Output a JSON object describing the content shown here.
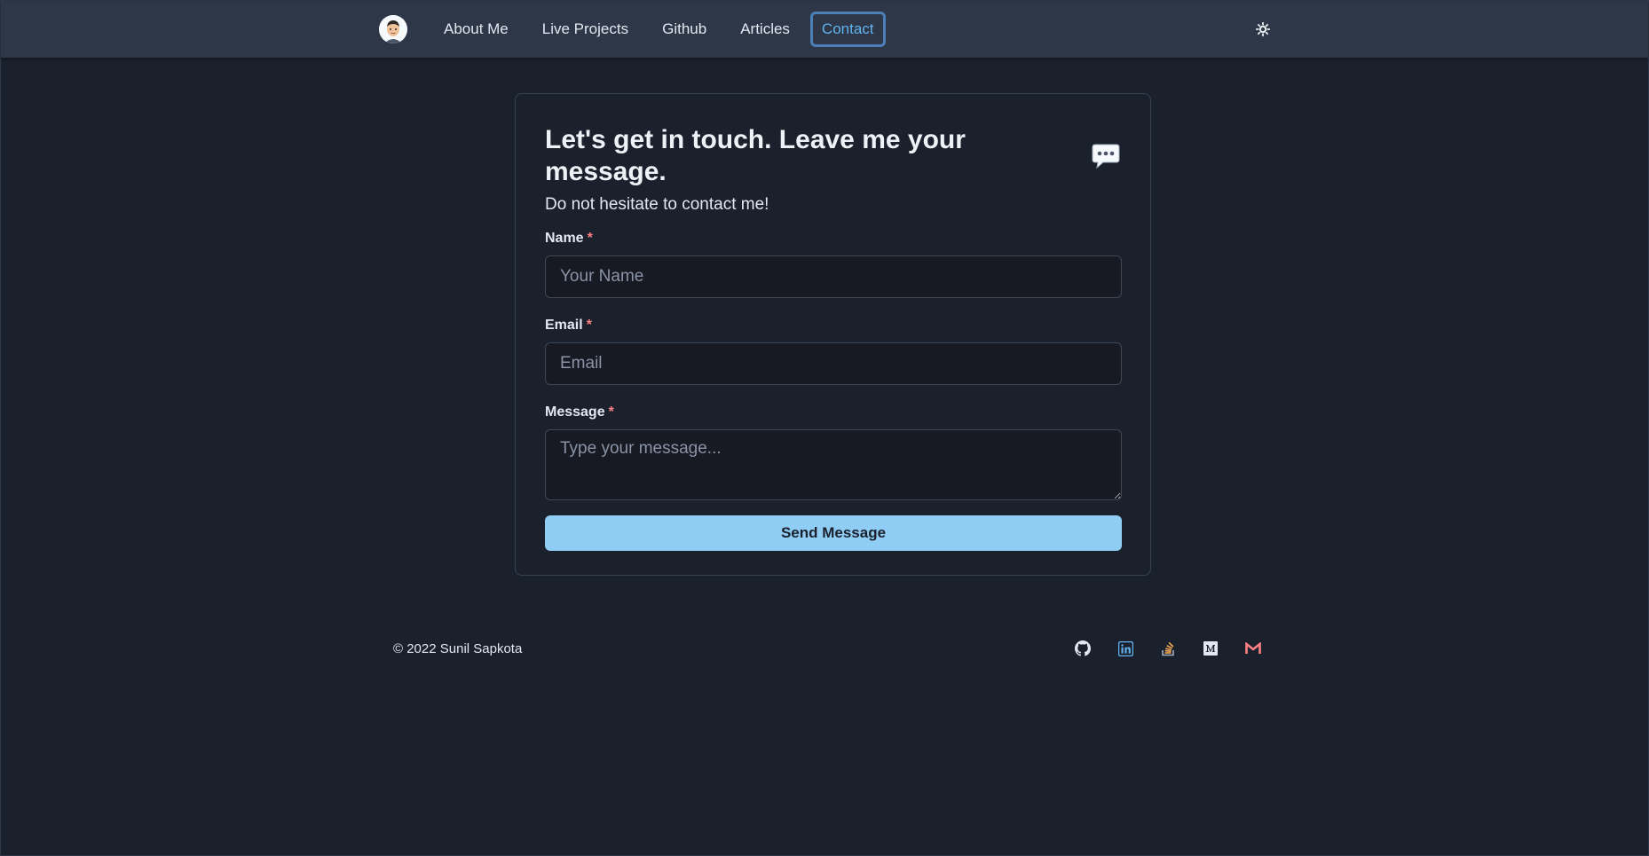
{
  "nav": {
    "avatar_alt": "avatar",
    "links": [
      {
        "label": "About Me"
      },
      {
        "label": "Live Projects"
      },
      {
        "label": "Github"
      },
      {
        "label": "Articles"
      },
      {
        "label": "Contact",
        "active": true
      }
    ],
    "theme_icon": "sun-icon"
  },
  "contact": {
    "title": "Let's get in touch. Leave me your message.",
    "title_icon": "speech-bubble-icon",
    "subtitle": "Do not hesitate to contact me!",
    "name": {
      "label": "Name",
      "required": "*",
      "placeholder": "Your Name",
      "value": ""
    },
    "email": {
      "label": "Email",
      "required": "*",
      "placeholder": "Email",
      "value": ""
    },
    "message": {
      "label": "Message",
      "required": "*",
      "placeholder": "Type your message...",
      "value": ""
    },
    "submit_label": "Send Message"
  },
  "footer": {
    "copyright": "© 2022 Sunil Sapkota",
    "socials": [
      {
        "icon": "github-icon",
        "color": "#e2e8f0"
      },
      {
        "icon": "linkedin-icon",
        "color": "#63b3ed"
      },
      {
        "icon": "stackoverflow-icon",
        "color": "#f6ad55"
      },
      {
        "icon": "medium-icon",
        "color": "#e2e8f0"
      },
      {
        "icon": "gmail-icon",
        "color": "#fc8181"
      }
    ]
  },
  "colors": {
    "background": "#1a202c",
    "navbar": "#2d3748",
    "accent": "#90cdf4",
    "active_link": "#63b3ed",
    "required": "#fc8181"
  }
}
